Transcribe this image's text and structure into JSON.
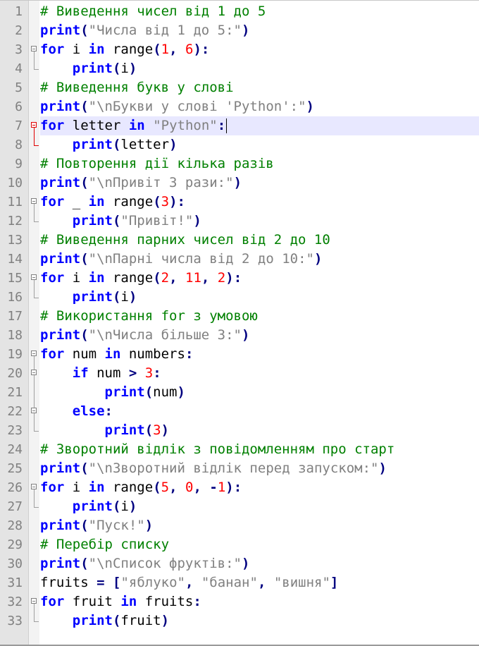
{
  "editor": {
    "language": "python",
    "current_line": 7,
    "lines": [
      {
        "n": "1",
        "fold": "none",
        "tokens": [
          [
            "cm",
            "# Виведення чисел від 1 до 5"
          ]
        ]
      },
      {
        "n": "2",
        "fold": "none",
        "tokens": [
          [
            "kw",
            "print"
          ],
          [
            "op",
            "("
          ],
          [
            "str",
            "\"Числа від 1 до 5:\""
          ],
          [
            "op",
            ")"
          ]
        ]
      },
      {
        "n": "3",
        "fold": "start",
        "tokens": [
          [
            "kw",
            "for"
          ],
          [
            "",
            " i "
          ],
          [
            "kw",
            "in"
          ],
          [
            "",
            " range"
          ],
          [
            "op",
            "("
          ],
          [
            "num",
            "1"
          ],
          [
            "op",
            ","
          ],
          [
            "",
            " "
          ],
          [
            "num",
            "6"
          ],
          [
            "op",
            "):"
          ]
        ]
      },
      {
        "n": "4",
        "fold": "end",
        "tokens": [
          [
            "",
            "    "
          ],
          [
            "kw",
            "print"
          ],
          [
            "op",
            "("
          ],
          [
            "",
            "i"
          ],
          [
            "op",
            ")"
          ]
        ]
      },
      {
        "n": "5",
        "fold": "none",
        "tokens": [
          [
            "cm",
            "# Виведення букв у слові"
          ]
        ]
      },
      {
        "n": "6",
        "fold": "none",
        "tokens": [
          [
            "kw",
            "print"
          ],
          [
            "op",
            "("
          ],
          [
            "str",
            "\"\\nБукви у слові 'Python':\""
          ],
          [
            "op",
            ")"
          ]
        ]
      },
      {
        "n": "7",
        "fold": "start-red",
        "tokens": [
          [
            "kw",
            "for"
          ],
          [
            "",
            " letter "
          ],
          [
            "kw",
            "in"
          ],
          [
            "",
            " "
          ],
          [
            "str",
            "\"Python\""
          ],
          [
            "op",
            ":"
          ]
        ]
      },
      {
        "n": "8",
        "fold": "end-red",
        "tokens": [
          [
            "",
            "    "
          ],
          [
            "kw",
            "print"
          ],
          [
            "op",
            "("
          ],
          [
            "",
            "letter"
          ],
          [
            "op",
            ")"
          ]
        ]
      },
      {
        "n": "9",
        "fold": "none",
        "tokens": [
          [
            "cm",
            "# Повторення дії кілька разів"
          ]
        ]
      },
      {
        "n": "10",
        "fold": "none",
        "tokens": [
          [
            "kw",
            "print"
          ],
          [
            "op",
            "("
          ],
          [
            "str",
            "\"\\nПривіт 3 рази:\""
          ],
          [
            "op",
            ")"
          ]
        ]
      },
      {
        "n": "11",
        "fold": "start",
        "tokens": [
          [
            "kw",
            "for"
          ],
          [
            "",
            " _ "
          ],
          [
            "kw",
            "in"
          ],
          [
            "",
            " range"
          ],
          [
            "op",
            "("
          ],
          [
            "num",
            "3"
          ],
          [
            "op",
            "):"
          ]
        ]
      },
      {
        "n": "12",
        "fold": "end",
        "tokens": [
          [
            "",
            "    "
          ],
          [
            "kw",
            "print"
          ],
          [
            "op",
            "("
          ],
          [
            "str",
            "\"Привіт!\""
          ],
          [
            "op",
            ")"
          ]
        ]
      },
      {
        "n": "13",
        "fold": "none",
        "tokens": [
          [
            "cm",
            "# Виведення парних чисел від 2 до 10"
          ]
        ]
      },
      {
        "n": "14",
        "fold": "none",
        "tokens": [
          [
            "kw",
            "print"
          ],
          [
            "op",
            "("
          ],
          [
            "str",
            "\"\\nПарні числа від 2 до 10:\""
          ],
          [
            "op",
            ")"
          ]
        ]
      },
      {
        "n": "15",
        "fold": "start",
        "tokens": [
          [
            "kw",
            "for"
          ],
          [
            "",
            " i "
          ],
          [
            "kw",
            "in"
          ],
          [
            "",
            " range"
          ],
          [
            "op",
            "("
          ],
          [
            "num",
            "2"
          ],
          [
            "op",
            ","
          ],
          [
            "",
            " "
          ],
          [
            "num",
            "11"
          ],
          [
            "op",
            ","
          ],
          [
            "",
            " "
          ],
          [
            "num",
            "2"
          ],
          [
            "op",
            "):"
          ]
        ]
      },
      {
        "n": "16",
        "fold": "end",
        "tokens": [
          [
            "",
            "    "
          ],
          [
            "kw",
            "print"
          ],
          [
            "op",
            "("
          ],
          [
            "",
            "i"
          ],
          [
            "op",
            ")"
          ]
        ]
      },
      {
        "n": "17",
        "fold": "none",
        "tokens": [
          [
            "cm",
            "# Використання for з умовою"
          ]
        ]
      },
      {
        "n": "18",
        "fold": "none",
        "tokens": [
          [
            "kw",
            "print"
          ],
          [
            "op",
            "("
          ],
          [
            "str",
            "\"\\nЧисла більше 3:\""
          ],
          [
            "op",
            ")"
          ]
        ]
      },
      {
        "n": "19",
        "fold": "start",
        "tokens": [
          [
            "kw",
            "for"
          ],
          [
            "",
            " num "
          ],
          [
            "kw",
            "in"
          ],
          [
            "",
            " numbers"
          ],
          [
            "op",
            ":"
          ]
        ]
      },
      {
        "n": "20",
        "fold": "start-inner",
        "tokens": [
          [
            "",
            "    "
          ],
          [
            "kw",
            "if"
          ],
          [
            "",
            " num "
          ],
          [
            "op",
            ">"
          ],
          [
            "",
            " "
          ],
          [
            "num",
            "3"
          ],
          [
            "op",
            ":"
          ]
        ]
      },
      {
        "n": "21",
        "fold": "line",
        "tokens": [
          [
            "",
            "        "
          ],
          [
            "kw",
            "print"
          ],
          [
            "op",
            "("
          ],
          [
            "",
            "num"
          ],
          [
            "op",
            ")"
          ]
        ]
      },
      {
        "n": "22",
        "fold": "start-inner",
        "tokens": [
          [
            "",
            "    "
          ],
          [
            "kw",
            "else"
          ],
          [
            "op",
            ":"
          ]
        ]
      },
      {
        "n": "23",
        "fold": "end",
        "tokens": [
          [
            "",
            "        "
          ],
          [
            "kw",
            "print"
          ],
          [
            "op",
            "("
          ],
          [
            "num",
            "3"
          ],
          [
            "op",
            ")"
          ]
        ]
      },
      {
        "n": "24",
        "fold": "none",
        "tokens": [
          [
            "cm",
            "# Зворотний відлік з повідомленням про старт"
          ]
        ]
      },
      {
        "n": "25",
        "fold": "none",
        "tokens": [
          [
            "kw",
            "print"
          ],
          [
            "op",
            "("
          ],
          [
            "str",
            "\"\\nЗворотний відлік перед запуском:\""
          ],
          [
            "op",
            ")"
          ]
        ]
      },
      {
        "n": "26",
        "fold": "start",
        "tokens": [
          [
            "kw",
            "for"
          ],
          [
            "",
            " i "
          ],
          [
            "kw",
            "in"
          ],
          [
            "",
            " range"
          ],
          [
            "op",
            "("
          ],
          [
            "num",
            "5"
          ],
          [
            "op",
            ","
          ],
          [
            "",
            " "
          ],
          [
            "num",
            "0"
          ],
          [
            "op",
            ","
          ],
          [
            "",
            " "
          ],
          [
            "op",
            "-"
          ],
          [
            "num",
            "1"
          ],
          [
            "op",
            "):"
          ]
        ]
      },
      {
        "n": "27",
        "fold": "end",
        "tokens": [
          [
            "",
            "    "
          ],
          [
            "kw",
            "print"
          ],
          [
            "op",
            "("
          ],
          [
            "",
            "i"
          ],
          [
            "op",
            ")"
          ]
        ]
      },
      {
        "n": "28",
        "fold": "none",
        "tokens": [
          [
            "kw",
            "print"
          ],
          [
            "op",
            "("
          ],
          [
            "str",
            "\"Пуск!\""
          ],
          [
            "op",
            ")"
          ]
        ]
      },
      {
        "n": "29",
        "fold": "none",
        "tokens": [
          [
            "cm",
            "# Перебір списку"
          ]
        ]
      },
      {
        "n": "30",
        "fold": "none",
        "tokens": [
          [
            "kw",
            "print"
          ],
          [
            "op",
            "("
          ],
          [
            "str",
            "\"\\nСписок фруктів:\""
          ],
          [
            "op",
            ")"
          ]
        ]
      },
      {
        "n": "31",
        "fold": "none",
        "tokens": [
          [
            "",
            "fruits "
          ],
          [
            "op",
            "="
          ],
          [
            "",
            " "
          ],
          [
            "op",
            "["
          ],
          [
            "str",
            "\"яблуко\""
          ],
          [
            "op",
            ","
          ],
          [
            "",
            " "
          ],
          [
            "str",
            "\"банан\""
          ],
          [
            "op",
            ","
          ],
          [
            "",
            " "
          ],
          [
            "str",
            "\"вишня\""
          ],
          [
            "op",
            "]"
          ]
        ]
      },
      {
        "n": "32",
        "fold": "start",
        "tokens": [
          [
            "kw",
            "for"
          ],
          [
            "",
            " fruit "
          ],
          [
            "kw",
            "in"
          ],
          [
            "",
            " fruits"
          ],
          [
            "op",
            ":"
          ]
        ]
      },
      {
        "n": "33",
        "fold": "end",
        "tokens": [
          [
            "",
            "    "
          ],
          [
            "kw",
            "print"
          ],
          [
            "op",
            "("
          ],
          [
            "",
            "fruit"
          ],
          [
            "op",
            ")"
          ]
        ]
      }
    ]
  }
}
